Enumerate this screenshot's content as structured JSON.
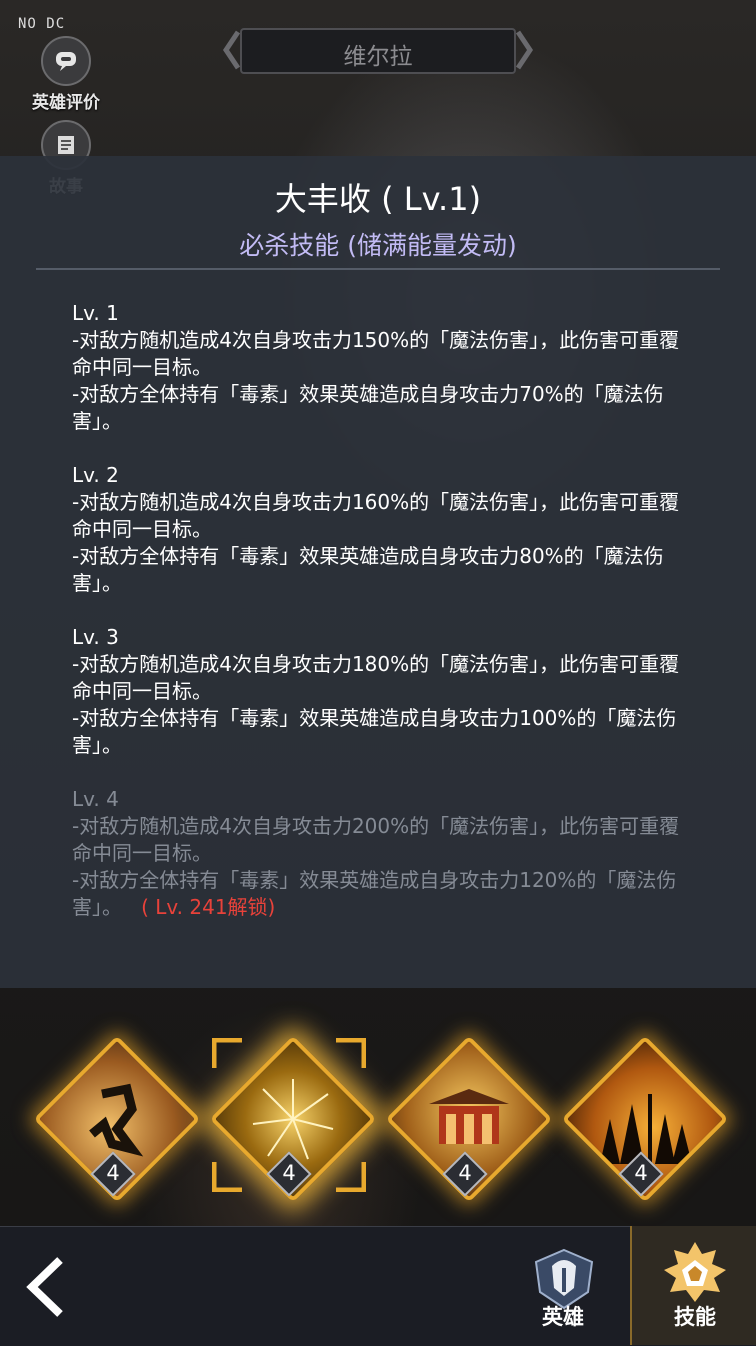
{
  "debug_label": "NO DC",
  "side_buttons": {
    "rating_label": "英雄评价",
    "story_label": "故事"
  },
  "hero_name": "维尔拉",
  "skill": {
    "title": "大丰收 ( Lv.1)",
    "type": "必杀技能 (储满能量发动)"
  },
  "levels": [
    {
      "label": "Lv. 1",
      "line1": "-对敌方随机造成4次自身攻击力150%的「魔法伤害」，此伤害可重覆命中同一目标。",
      "line2": "-对敌方全体持有「毒素」效果英雄造成自身攻击力70%的「魔法伤害」。",
      "unlock": ""
    },
    {
      "label": "Lv. 2",
      "line1": "-对敌方随机造成4次自身攻击力160%的「魔法伤害」，此伤害可重覆命中同一目标。",
      "line2": "-对敌方全体持有「毒素」效果英雄造成自身攻击力80%的「魔法伤害」。",
      "unlock": ""
    },
    {
      "label": "Lv. 3",
      "line1": "-对敌方随机造成4次自身攻击力180%的「魔法伤害」，此伤害可重覆命中同一目标。",
      "line2": "-对敌方全体持有「毒素」效果英雄造成自身攻击力100%的「魔法伤害」。",
      "unlock": ""
    },
    {
      "label": "Lv. 4",
      "line1": "-对敌方随机造成4次自身攻击力200%的「魔法伤害」，此伤害可重覆命中同一目标。",
      "line2": "-对敌方全体持有「毒素」效果英雄造成自身攻击力120%的「魔法伤害」。",
      "unlock": "( Lv. 241解锁)"
    }
  ],
  "skill_slots": [
    {
      "level": "4",
      "icon": "running-figure-icon"
    },
    {
      "level": "4",
      "icon": "fireworks-icon",
      "selected": true
    },
    {
      "level": "4",
      "icon": "temple-icon"
    },
    {
      "level": "4",
      "icon": "forest-sunset-icon"
    }
  ],
  "bottom_tabs": {
    "hero_label": "英雄",
    "skill_label": "技能"
  },
  "colors": {
    "accent_gold": "#e8a92e",
    "subtitle_purple": "#c2bbf4",
    "locked_red": "#e8423a"
  }
}
